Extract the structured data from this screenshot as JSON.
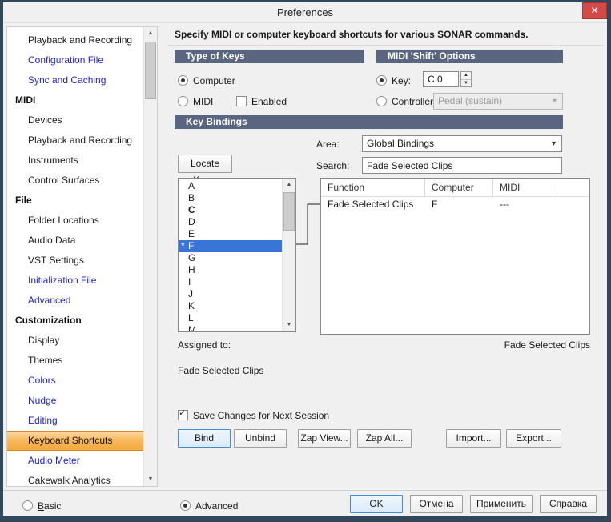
{
  "window": {
    "title": "Preferences",
    "close_glyph": "✕"
  },
  "icons": {
    "arrow_up": "▲",
    "arrow_down": "▼",
    "chevron_down": "▾",
    "check": "✓"
  },
  "instruction": "Specify MIDI or computer keyboard shortcuts for various SONAR commands.",
  "sidebar": {
    "items": [
      {
        "label": "Playback and Recording"
      },
      {
        "label": "Configuration File"
      },
      {
        "label": "Sync and Caching"
      },
      {
        "label": "MIDI"
      },
      {
        "label": "Devices"
      },
      {
        "label": "Playback and Recording"
      },
      {
        "label": "Instruments"
      },
      {
        "label": "Control Surfaces"
      },
      {
        "label": "File"
      },
      {
        "label": "Folder Locations"
      },
      {
        "label": "Audio Data"
      },
      {
        "label": "VST Settings"
      },
      {
        "label": "Initialization File"
      },
      {
        "label": "Advanced"
      },
      {
        "label": "Customization"
      },
      {
        "label": "Display"
      },
      {
        "label": "Themes"
      },
      {
        "label": "Colors"
      },
      {
        "label": "Nudge"
      },
      {
        "label": "Editing"
      },
      {
        "label": "Keyboard Shortcuts"
      },
      {
        "label": "Audio Meter"
      },
      {
        "label": "Cakewalk Analytics"
      }
    ]
  },
  "type_of_keys": {
    "title": "Type of Keys",
    "computer_label": "Computer",
    "midi_label": "MIDI",
    "enabled_label": "Enabled"
  },
  "midi_shift": {
    "title": "MIDI 'Shift' Options",
    "key_label": "Key:",
    "key_value": "C 0",
    "controller_label": "Controller:",
    "controller_value": "Pedal (sustain)"
  },
  "key_bindings": {
    "title": "Key Bindings",
    "area_label": "Area:",
    "area_value": "Global Bindings",
    "search_label": "Search:",
    "search_value": "Fade Selected Clips",
    "locate_key_label": "Locate Key..."
  },
  "keys_list": {
    "marker": "*",
    "items": [
      "A",
      "B",
      "C",
      "D",
      "E",
      "F",
      "G",
      "H",
      "I",
      "J",
      "K",
      "L",
      "M"
    ]
  },
  "bindings_table": {
    "columns": [
      "Function",
      "Computer",
      "MIDI"
    ],
    "rows": [
      {
        "function": "Fade Selected Clips",
        "computer": "F",
        "midi": "---"
      }
    ]
  },
  "assigned": {
    "label": "Assigned to:",
    "right_value": "Fade Selected Clips",
    "left_value": "Fade Selected Clips"
  },
  "session": {
    "save_label": "Save Changes for Next Session"
  },
  "actions": {
    "bind": "Bind",
    "unbind": "Unbind",
    "zap_view": "Zap View...",
    "zap_all": "Zap All...",
    "import": "Import...",
    "export": "Export..."
  },
  "footer": {
    "basic_first": "B",
    "basic_rest": "asic",
    "advanced_label": "Advanced",
    "ok": "OK",
    "cancel": "Отмена",
    "apply_first": "П",
    "apply_rest": "рименить",
    "help": "Справка"
  }
}
